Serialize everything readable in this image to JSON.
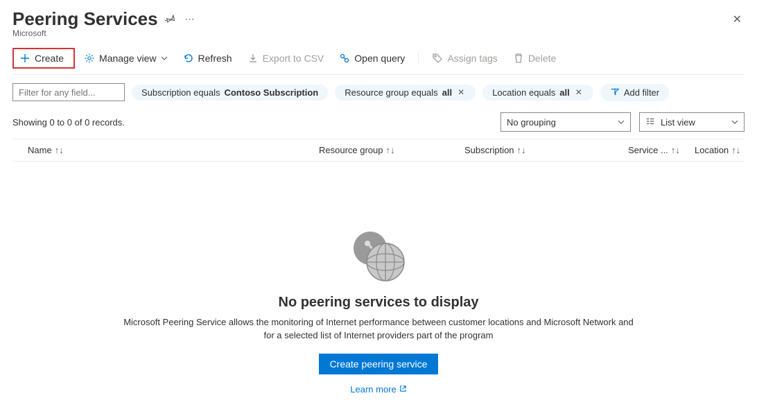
{
  "header": {
    "title": "Peering Services",
    "subtitle": "Microsoft"
  },
  "toolbar": {
    "create": "Create",
    "manage_view": "Manage view",
    "refresh": "Refresh",
    "export_csv": "Export to CSV",
    "open_query": "Open query",
    "assign_tags": "Assign tags",
    "delete": "Delete"
  },
  "filters": {
    "placeholder": "Filter for any field...",
    "subscription": {
      "prefix": "Subscription equals ",
      "value": "Contoso Subscription"
    },
    "resource_group": {
      "prefix": "Resource group equals ",
      "value": "all"
    },
    "location": {
      "prefix": "Location equals ",
      "value": "all"
    },
    "add_filter": "Add filter"
  },
  "status": {
    "records": "Showing 0 to 0 of 0 records.",
    "grouping": "No grouping",
    "listview": "List view"
  },
  "columns": {
    "name": "Name",
    "resource_group": "Resource group",
    "subscription": "Subscription",
    "service": "Service ...",
    "location": "Location"
  },
  "empty": {
    "title": "No peering services to display",
    "text": "Microsoft Peering Service allows the monitoring of Internet performance between customer locations and Microsoft Network and for a selected list of Internet providers part of the program",
    "button": "Create peering service",
    "learn_more": "Learn more"
  }
}
